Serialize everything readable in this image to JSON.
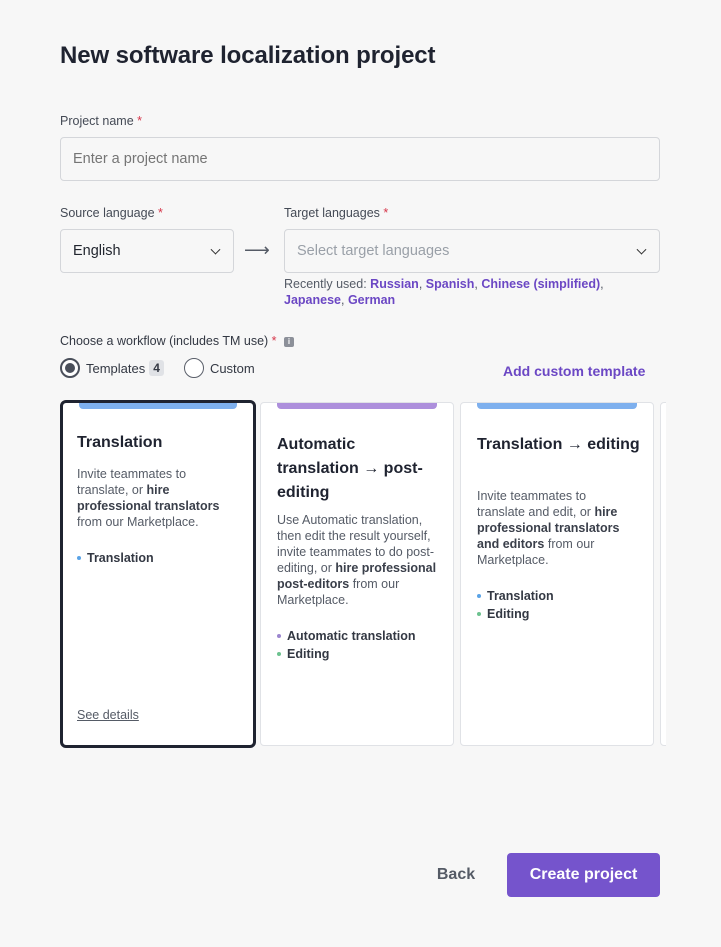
{
  "page": {
    "title": "New software localization project"
  },
  "project_name": {
    "label": "Project name",
    "required_mark": "*",
    "placeholder": "Enter a project name"
  },
  "source_language": {
    "label": "Source language",
    "required_mark": "*",
    "value": "English"
  },
  "arrow": "⟶",
  "target_languages": {
    "label": "Target languages",
    "required_mark": "*",
    "placeholder": "Select target languages",
    "recently_used_label": "Recently used:",
    "recent": [
      "Russian",
      "Spanish",
      "Chinese (simplified)",
      "Japanese",
      "German"
    ]
  },
  "workflow": {
    "label": "Choose a workflow (includes TM use)",
    "required_mark": "*",
    "info_icon": "i",
    "options": {
      "templates": "Templates",
      "templates_count": "4",
      "custom": "Custom"
    },
    "add_custom_template": "Add custom template"
  },
  "cards": [
    {
      "title": "Translation",
      "stripe_color": "#7eb0ee",
      "desc_parts": [
        "Invite teammates to translate, or ",
        "hire professional translators",
        " from our Marketplace."
      ],
      "steps": [
        {
          "label": "Translation",
          "color": "#5aa3e6"
        }
      ],
      "see_details": "See details"
    },
    {
      "title": "Automatic translation → post-editing",
      "stripe_color": "#ad8fdc",
      "desc_parts": [
        "Use Automatic translation, then edit the result yourself, invite teammates to do post-editing, or ",
        "hire professional post-editors",
        " from our Marketplace."
      ],
      "steps": [
        {
          "label": "Automatic translation",
          "color": "#9c86cf"
        },
        {
          "label": "Editing",
          "color": "#6cc28f"
        }
      ]
    },
    {
      "title": "Translation → editing",
      "stripe_color": "#7eb0ee",
      "desc_parts": [
        "Invite teammates to translate and edit, or ",
        "hire professional translators and editors",
        " from our Marketplace."
      ],
      "steps": [
        {
          "label": "Translation",
          "color": "#5aa3e6"
        },
        {
          "label": "Editing",
          "color": "#6cc28f"
        }
      ]
    }
  ],
  "footer": {
    "back": "Back",
    "create": "Create project"
  }
}
